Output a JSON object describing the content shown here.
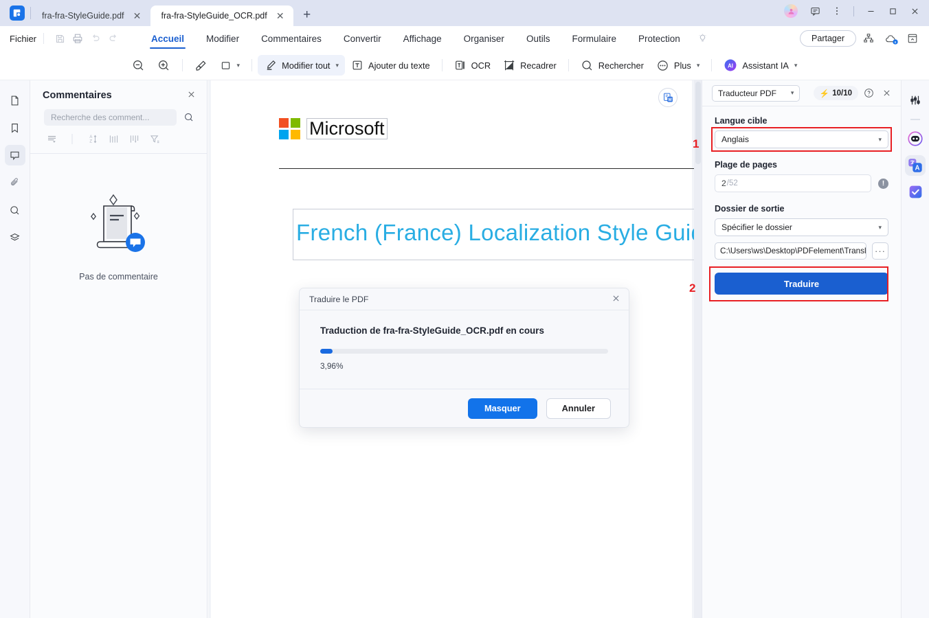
{
  "titlebar": {
    "tabs": [
      {
        "label": "fra-fra-StyleGuide.pdf",
        "active": false
      },
      {
        "label": "fra-fra-StyleGuide_OCR.pdf",
        "active": true
      }
    ],
    "new_tab": "+",
    "close_glyph": "✕",
    "minimize": "—",
    "maximize": "□",
    "close": "✕"
  },
  "menubar": {
    "file": "Fichier",
    "ribbon_tabs": [
      "Accueil",
      "Modifier",
      "Commentaires",
      "Convertir",
      "Affichage",
      "Organiser",
      "Outils",
      "Formulaire",
      "Protection"
    ],
    "active_tab": "Accueil",
    "share_label": "Partager"
  },
  "toolbar": {
    "zoom_out": "zoom-out",
    "zoom_in": "zoom-in",
    "highlight": "highlighter",
    "shape": "rectangle",
    "edit_all": "Modifier tout",
    "add_text": "Ajouter du texte",
    "ocr": "OCR",
    "crop": "Recadrer",
    "search": "Rechercher",
    "more": "Plus",
    "ai_assistant": "Assistant IA",
    "ai_badge": "AI"
  },
  "comments_panel": {
    "title": "Commentaires",
    "search_placeholder": "Recherche des comment...",
    "empty_label": "Pas de commentaire"
  },
  "document": {
    "brand": "Microsoft",
    "title": "French (France) Localization Style Guide",
    "title_color": "#29ade3"
  },
  "translator": {
    "panel_name": "Traducteur PDF",
    "credits": "10/10",
    "credits_icon": "⚡",
    "help_icon": "?",
    "close_icon": "✕",
    "target_language_label": "Langue cible",
    "target_language_value": "Anglais",
    "page_range_label": "Plage de pages",
    "page_range_value": "2",
    "page_range_total": "/52",
    "output_folder_label": "Dossier de sortie",
    "output_folder_mode": "Spécifier le dossier",
    "output_path": "C:\\Users\\ws\\Desktop\\PDFelement\\Translat",
    "browse_label": "···",
    "translate_label": "Traduire",
    "callouts": [
      "1",
      "2"
    ],
    "callout_color": "#e81f23"
  },
  "modal": {
    "title": "Traduire le PDF",
    "close_icon": "✕",
    "message": "Traduction de fra-fra-StyleGuide_OCR.pdf en cours",
    "progress_percent": "3,96%",
    "progress_value": 3.96,
    "hide_label": "Masquer",
    "cancel_label": "Annuler"
  }
}
